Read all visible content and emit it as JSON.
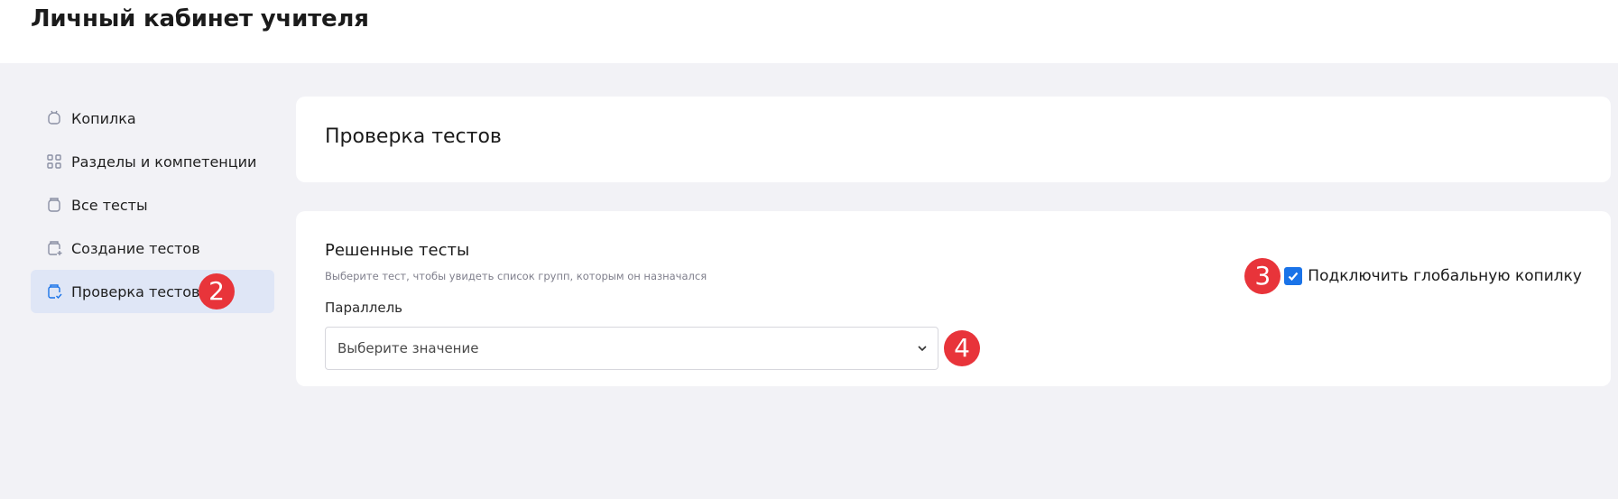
{
  "app": {
    "title": "Личный кабинет учителя"
  },
  "sidebar": {
    "items": [
      {
        "label": "Копилка",
        "icon": "piggy-bank-icon"
      },
      {
        "label": "Разделы и компетенции",
        "icon": "grid-icon"
      },
      {
        "label": "Все тесты",
        "icon": "tests-jar-icon"
      },
      {
        "label": "Создание тестов",
        "icon": "create-test-icon"
      },
      {
        "label": "Проверка тестов",
        "icon": "check-test-icon",
        "active": true
      }
    ]
  },
  "page": {
    "title": "Проверка тестов"
  },
  "solved": {
    "title": "Решенные тесты",
    "hint": "Выберите тест, чтобы увидеть список групп, которым он назначался",
    "parallel_label": "Параллель",
    "parallel_value": "Выберите значение",
    "global_bank_label": "Подключить глобальную копилку",
    "global_bank_checked": true
  },
  "annotations": {
    "marker_2": "2",
    "marker_3": "3",
    "marker_4": "4"
  },
  "colors": {
    "accent": "#1a73e8",
    "active_nav_bg": "#dfe6f6",
    "marker": "#e8343a",
    "page_bg": "#f2f2f6"
  }
}
